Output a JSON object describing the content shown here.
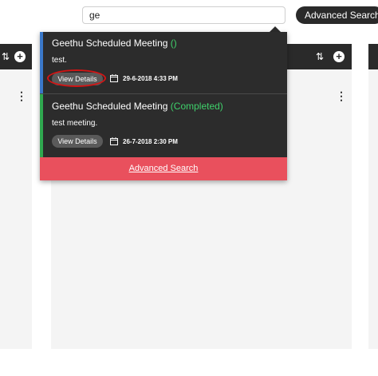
{
  "search": {
    "value": "ge"
  },
  "header": {
    "advanced_search_label": "Advanced Search"
  },
  "results": [
    {
      "title": "Geethu Scheduled Meeting",
      "status": "()",
      "description": "test.",
      "button": "View Details",
      "datetime": "29-6-2018 4:33 PM"
    },
    {
      "title": "Geethu Scheduled Meeting",
      "status": "(Completed)",
      "description": "test meeting.",
      "button": "View Details",
      "datetime": "26-7-2018 2:30 PM"
    }
  ],
  "dropdown": {
    "advanced_search_link": "Advanced Search"
  },
  "icons": {
    "sort": "sort-arrows-icon",
    "add": "plus-circle-icon",
    "menu": "kebab-menu-icon",
    "calendar": "calendar-icon"
  },
  "colors": {
    "accent": "#e9505d",
    "item1_bar": "#3a78c9",
    "item2_bar": "#2fa84f",
    "completed": "#3fd16b",
    "annotation": "#d21414"
  }
}
